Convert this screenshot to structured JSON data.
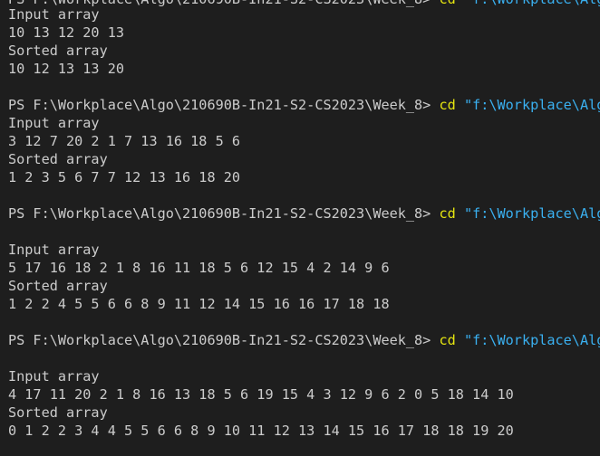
{
  "terminal": {
    "top_partial": {
      "prompt": "PS F:\\Workplace\\Algo\\210690B-In21-S2-CS2023\\Week_8>",
      "cmd": "cd",
      "arg": "\"f:\\Workplace\\Algo"
    },
    "block1": {
      "input_label": "Input array",
      "input_values": "10 13 12 20 13",
      "sorted_label": "Sorted array",
      "sorted_values": "10 12 13 13 20"
    },
    "block2": {
      "prompt": "PS F:\\Workplace\\Algo\\210690B-In21-S2-CS2023\\Week_8>",
      "cmd": "cd",
      "arg": "\"f:\\Workplace\\Algo",
      "input_label": "Input array",
      "input_values": "3 12 7 20 2 1 7 13 16 18 5 6",
      "sorted_label": "Sorted array",
      "sorted_values": "1 2 3 5 6 7 7 12 13 16 18 20"
    },
    "block3": {
      "prompt": "PS F:\\Workplace\\Algo\\210690B-In21-S2-CS2023\\Week_8>",
      "cmd": "cd",
      "arg": "\"f:\\Workplace\\Algo",
      "input_label": "Input array",
      "input_values": "5 17 16 18 2 1 8 16 11 18 5 6 12 15 4 2 14 9 6",
      "sorted_label": "Sorted array",
      "sorted_values": "1 2 2 4 5 5 6 6 8 9 11 12 14 15 16 16 17 18 18"
    },
    "block4": {
      "prompt": "PS F:\\Workplace\\Algo\\210690B-In21-S2-CS2023\\Week_8>",
      "cmd": "cd",
      "arg": "\"f:\\Workplace\\Algo",
      "input_label": "Input array",
      "input_values": "4 17 11 20 2 1 8 16 13 18 5 6 19 15 4 3 12 9 6 2 0 5 18 14 10",
      "sorted_label": "Sorted array",
      "sorted_values": "0 1 2 2 3 4 4 5 5 6 6 8 9 10 11 12 13 14 15 16 17 18 18 19 20"
    },
    "colors": {
      "background": "#1e1e1e",
      "text": "#cccccc",
      "command": "#e5e510",
      "argument": "#3ab0f0"
    }
  }
}
